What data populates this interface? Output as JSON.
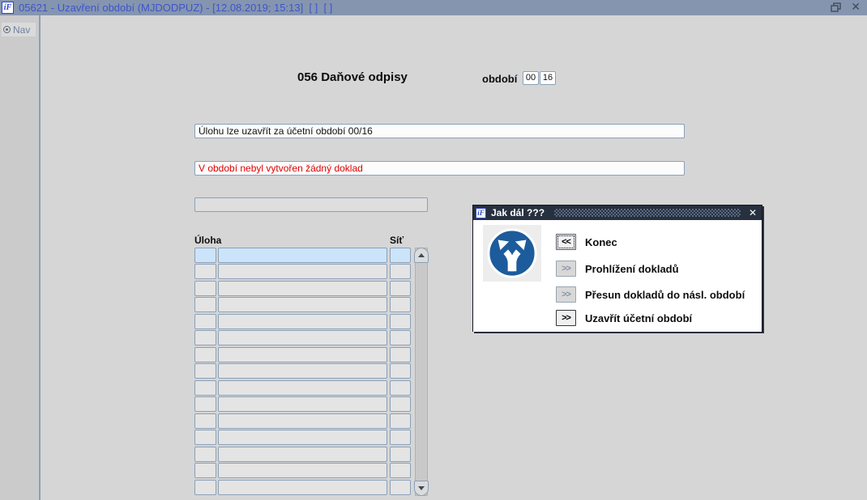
{
  "window": {
    "icon_text": "íF",
    "title": "05621 - Uzavření období (MJDODPUZ) - [12.08.2019; 15:13]  [ ]  [ ]"
  },
  "sidebar": {
    "nav_label": "Nav"
  },
  "form": {
    "title": "056 Daňové odpisy",
    "period": {
      "label": "období",
      "value1": "00",
      "value2": "16"
    },
    "info_message": "Úlohu lze uzavřít za účetní období 00/16",
    "warning_message": "V období nebyl vytvořen žádný doklad",
    "empty_field_value": "",
    "table": {
      "col_uloha": "Úloha",
      "col_sit": "Síť",
      "row_count": 15,
      "selected_row_index": 0
    }
  },
  "dialog": {
    "icon_text": "íF",
    "title": "Jak dál ???",
    "close_glyph": "✕",
    "buttons": [
      {
        "glyph": "<<",
        "label": "Konec"
      },
      {
        "glyph": ">>",
        "label": "Prohlížení dokladů"
      },
      {
        "glyph": ">>",
        "label": "Přesun dokladů do násl. období"
      },
      {
        "glyph": ">>",
        "label": "Uzavřít účetní období"
      }
    ]
  },
  "colors": {
    "window_titlebar": "#8695af",
    "title_text_blue": "#3b55cb",
    "warning_red": "#e00000",
    "selection_blue": "#cbe4fa",
    "dialog_titlebar": "#27303e",
    "sign_blue": "#1c5c9c"
  }
}
